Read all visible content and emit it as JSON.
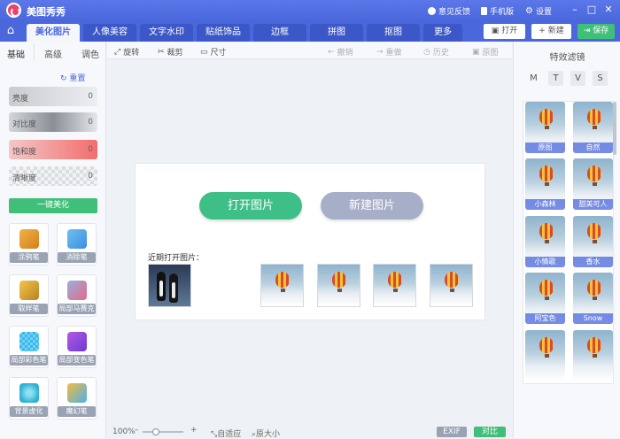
{
  "app": {
    "title": "美图秀秀"
  },
  "titlebar": {
    "feedback": "意见反馈",
    "mobile": "手机版",
    "settings": "设置"
  },
  "nav": {
    "tabs": [
      "美化图片",
      "人像美容",
      "文字水印",
      "贴纸饰品",
      "边框",
      "拼图",
      "抠图",
      "更多"
    ],
    "open": "打开",
    "new": "新建",
    "save": "保存"
  },
  "sidebar": {
    "subtabs": [
      "基础",
      "高级",
      "调色"
    ],
    "reset": "重置",
    "adjust": [
      {
        "label": "亮度",
        "value": "0"
      },
      {
        "label": "对比度",
        "value": "0"
      },
      {
        "label": "饱和度",
        "value": "0"
      },
      {
        "label": "清晰度",
        "value": "0"
      }
    ],
    "one_key": "一键美化",
    "tools": [
      "涂鸦笔",
      "消除笔",
      "取样笔",
      "局部马赛克",
      "局部彩色笔",
      "局部变色笔",
      "背景虚化",
      "魔幻笔"
    ]
  },
  "toolbar": {
    "rotate": "旋转",
    "crop": "裁剪",
    "size": "尺寸",
    "undo": "撤销",
    "redo": "重做",
    "history": "历史",
    "original": "原图"
  },
  "canvas": {
    "open_image": "打开图片",
    "new_image": "新建图片",
    "recent_label": "近期打开图片："
  },
  "status": {
    "zoom": "100%",
    "fit": "自适应",
    "actual": "原大小",
    "exif": "EXIF",
    "compare": "对比"
  },
  "rpanel": {
    "title": "特效滤镜",
    "filter_tabs": [
      "M",
      "T",
      "V",
      "S"
    ],
    "filters": [
      "原图",
      "自然",
      "小森林",
      "甜美可人",
      "小情歌",
      "香水",
      "阿宝色",
      "Snow",
      "",
      ""
    ]
  },
  "colors": {
    "accent": "#4a67dc",
    "green": "#3fbf79",
    "logo": "#e8436b"
  }
}
